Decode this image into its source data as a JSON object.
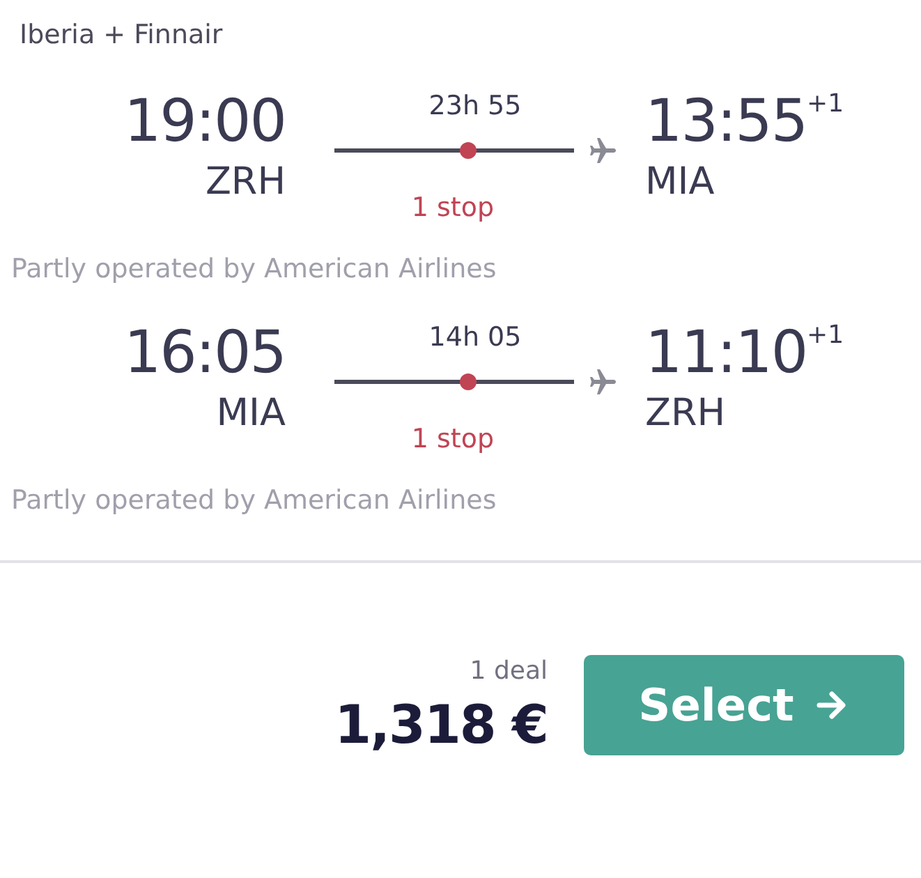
{
  "carrier": "Iberia + Finnair",
  "legs": [
    {
      "depart_time": "19:00",
      "depart_airport": "ZRH",
      "duration": "23h 55",
      "stops": "1 stop",
      "arrive_time": "13:55",
      "arrive_offset": "+1",
      "arrive_airport": "MIA",
      "note": "Partly operated by American Airlines"
    },
    {
      "depart_time": "16:05",
      "depart_airport": "MIA",
      "duration": "14h 05",
      "stops": "1 stop",
      "arrive_time": "11:10",
      "arrive_offset": "+1",
      "arrive_airport": "ZRH",
      "note": "Partly operated by American Airlines"
    }
  ],
  "deals": "1 deal",
  "price": "1,318 €",
  "button": "Select"
}
